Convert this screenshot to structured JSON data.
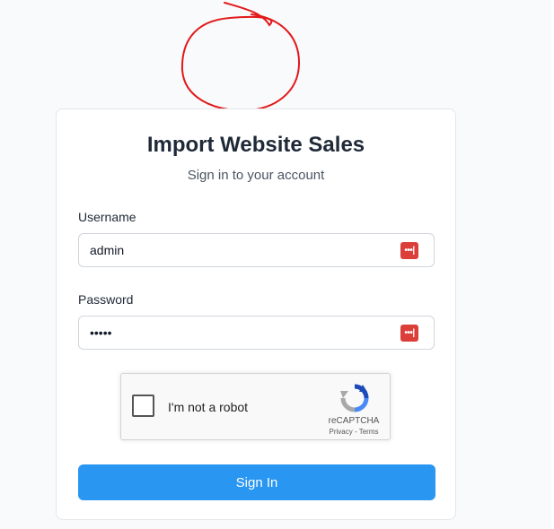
{
  "login": {
    "title": "Import Website Sales",
    "subtitle": "Sign in to your account",
    "username_label": "Username",
    "username_value": "admin",
    "password_label": "Password",
    "password_value": "admin",
    "password_manager_icon": "password-manager-icon",
    "submit_label": "Sign In"
  },
  "captcha": {
    "checkbox_label": "I'm not a robot",
    "brand": "reCAPTCHA",
    "links": "Privacy - Terms",
    "logo_icon": "recaptcha-logo-icon"
  },
  "colors": {
    "primary": "#2997f2",
    "annotation": "#e3191b",
    "password_icon": "#dc3f3a"
  }
}
